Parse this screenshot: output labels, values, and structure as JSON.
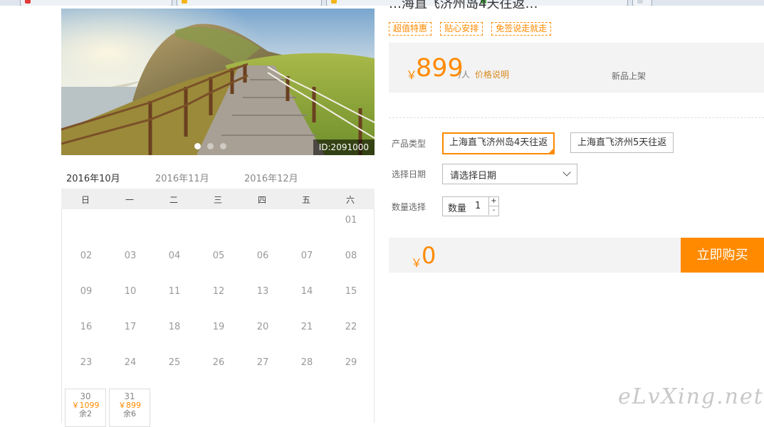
{
  "browser": {
    "tabs": [
      {
        "icon_color": "#e23a3a"
      },
      {
        "icon_color": "#f2b417"
      },
      {
        "icon_color": "#f2b417"
      },
      {
        "icon_color": "#4aa64a"
      },
      {
        "icon_color": "#cfd6de"
      }
    ]
  },
  "gallery": {
    "photo_id": "ID:2091000",
    "slide_count": 3,
    "active_slide": 1
  },
  "calendar": {
    "months": [
      "2016年10月",
      "2016年11月",
      "2016年12月"
    ],
    "active_month_index": 0,
    "weekdays": [
      "日",
      "一",
      "二",
      "三",
      "四",
      "五",
      "六"
    ],
    "days": [
      "01",
      "02",
      "03",
      "04",
      "05",
      "06",
      "07",
      "08",
      "09",
      "10",
      "11",
      "12",
      "13",
      "14",
      "15",
      "16",
      "17",
      "18",
      "19",
      "20",
      "21",
      "22",
      "23",
      "24",
      "25",
      "26",
      "27",
      "28",
      "29"
    ],
    "first_weekday_index": 6,
    "available": [
      {
        "day": "30",
        "price": "￥1099",
        "stock": "余2"
      },
      {
        "day": "31",
        "price": "￥899",
        "stock": "余6"
      }
    ]
  },
  "product": {
    "title_fragment": "…海直飞济州岛4天往返…",
    "tags": [
      "超值特惠",
      "贴心安排",
      "免签说走就走"
    ],
    "currency": "￥",
    "price": "899",
    "per_person": "/人",
    "price_note": "价格说明",
    "new_label": "新品上架"
  },
  "options": {
    "type_label": "产品类型",
    "types": [
      "上海直飞济州岛4天往返",
      "上海直飞济州5天往返"
    ],
    "selected_type_index": 0,
    "date_label": "选择日期",
    "date_placeholder": "请选择日期",
    "qty_label": "数量选择",
    "qty_prefix": "数量",
    "qty_value": "1",
    "qty_plus": "+",
    "qty_minus": "-"
  },
  "checkout": {
    "currency": "￥",
    "total": "0",
    "buy_label": "立即购买"
  },
  "watermark": "eLvXing.net",
  "colors": {
    "accent": "#ff8a00",
    "panel": "#f3f3f3"
  }
}
